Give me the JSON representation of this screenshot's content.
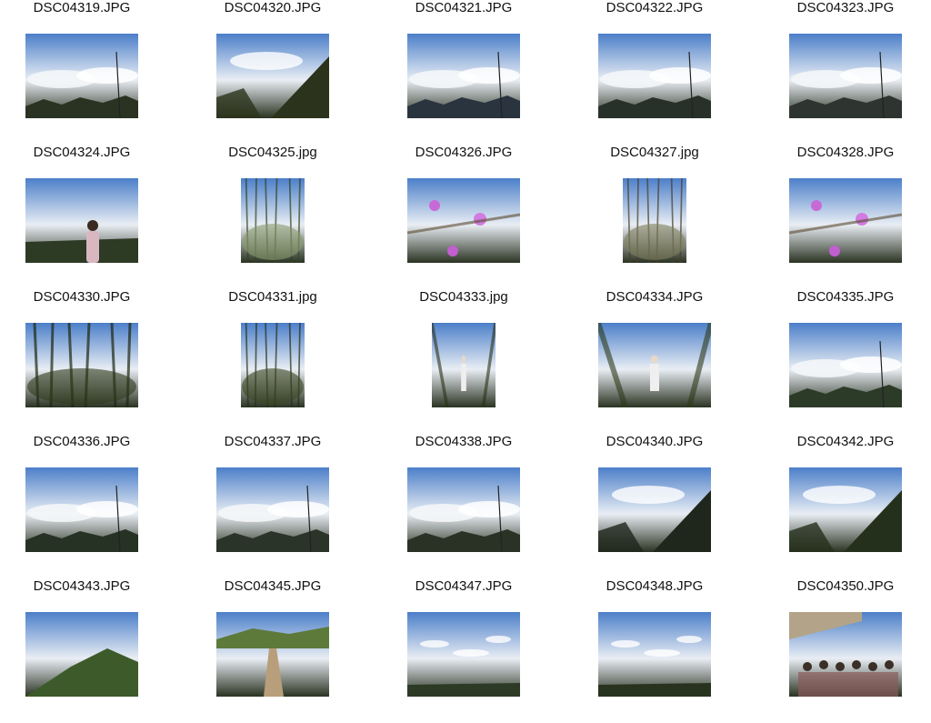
{
  "thumbnails": [
    {
      "filename": "DSC04319.JPG",
      "orientation": "landscape",
      "scene": "sky-clouds",
      "palette": {
        "top": "#4c7fc9",
        "mid": "#e9eef4",
        "bottom": "#2a3322"
      }
    },
    {
      "filename": "DSC04320.JPG",
      "orientation": "landscape",
      "scene": "sky-ridge",
      "palette": {
        "top": "#3f74c4",
        "mid": "#cfdcea",
        "bottom": "#2c331c"
      }
    },
    {
      "filename": "DSC04321.JPG",
      "orientation": "landscape",
      "scene": "sea-of-clouds",
      "palette": {
        "top": "#6e7d8c",
        "mid": "#eef1f4",
        "bottom": "#29343f"
      }
    },
    {
      "filename": "DSC04322.JPG",
      "orientation": "landscape",
      "scene": "sea-of-clouds",
      "palette": {
        "top": "#5f7fa5",
        "mid": "#e3e9ef",
        "bottom": "#27312a"
      }
    },
    {
      "filename": "DSC04323.JPG",
      "orientation": "landscape",
      "scene": "sea-of-clouds",
      "palette": {
        "top": "#8393a3",
        "mid": "#e2e6ea",
        "bottom": "#2e3430"
      }
    },
    {
      "filename": "DSC04324.JPG",
      "orientation": "landscape",
      "scene": "person-sky",
      "palette": {
        "top": "#4f83c9",
        "mid": "#e7ecf1",
        "bottom": "#2d3a24"
      }
    },
    {
      "filename": "DSC04325.jpg",
      "orientation": "portrait",
      "scene": "bamboo-sky",
      "palette": {
        "top": "#7fb0e0",
        "mid": "#8a9b6e",
        "bottom": "#2f4420"
      }
    },
    {
      "filename": "DSC04326.JPG",
      "orientation": "landscape",
      "scene": "flowers-ground",
      "palette": {
        "top": "#6a5a3e",
        "mid": "#8b7351",
        "bottom": "#4a3d28"
      }
    },
    {
      "filename": "DSC04327.jpg",
      "orientation": "portrait",
      "scene": "bamboo-trail",
      "palette": {
        "top": "#a9a98f",
        "mid": "#7e7f5e",
        "bottom": "#4a3e2a"
      }
    },
    {
      "filename": "DSC04328.JPG",
      "orientation": "landscape",
      "scene": "forest-floor",
      "palette": {
        "top": "#6e7a48",
        "mid": "#9a8e6c",
        "bottom": "#5d4e34"
      }
    },
    {
      "filename": "DSC04330.JPG",
      "orientation": "landscape",
      "scene": "dark-forest",
      "palette": {
        "top": "#5f6f3a",
        "mid": "#2f3b1c",
        "bottom": "#1f2812"
      }
    },
    {
      "filename": "DSC04331.jpg",
      "orientation": "portrait",
      "scene": "dark-forest",
      "palette": {
        "top": "#7b8a58",
        "mid": "#3a4522",
        "bottom": "#252e16"
      }
    },
    {
      "filename": "DSC04333.jpg",
      "orientation": "portrait",
      "scene": "hikers-forest",
      "palette": {
        "top": "#4a5f2c",
        "mid": "#33421e",
        "bottom": "#2a3118"
      }
    },
    {
      "filename": "DSC04334.JPG",
      "orientation": "landscape",
      "scene": "hikers-forest",
      "palette": {
        "top": "#51672f",
        "mid": "#3b4d22",
        "bottom": "#2d3a1a"
      }
    },
    {
      "filename": "DSC04335.JPG",
      "orientation": "landscape",
      "scene": "sea-of-clouds",
      "palette": {
        "top": "#3f7ad0",
        "mid": "#e8edf3",
        "bottom": "#2c3a28"
      }
    },
    {
      "filename": "DSC04336.JPG",
      "orientation": "landscape",
      "scene": "sea-of-clouds",
      "palette": {
        "top": "#2f6fc7",
        "mid": "#eef2f6",
        "bottom": "#263224"
      }
    },
    {
      "filename": "DSC04337.JPG",
      "orientation": "landscape",
      "scene": "sea-of-clouds",
      "palette": {
        "top": "#356fbf",
        "mid": "#e9eef3",
        "bottom": "#2a3428"
      }
    },
    {
      "filename": "DSC04338.JPG",
      "orientation": "landscape",
      "scene": "sea-of-clouds",
      "palette": {
        "top": "#3a74c2",
        "mid": "#e5eaf0",
        "bottom": "#2a3226"
      }
    },
    {
      "filename": "DSC04340.JPG",
      "orientation": "landscape",
      "scene": "dark-ridge-clouds",
      "palette": {
        "top": "#8aa3bd",
        "mid": "#eef1f4",
        "bottom": "#1f261c"
      }
    },
    {
      "filename": "DSC04342.JPG",
      "orientation": "landscape",
      "scene": "sky-ridge",
      "palette": {
        "top": "#5e8fd0",
        "mid": "#b9c9da",
        "bottom": "#25301c"
      }
    },
    {
      "filename": "DSC04343.JPG",
      "orientation": "landscape",
      "scene": "misty-ridge",
      "palette": {
        "top": "#c9cdd0",
        "mid": "#a7aeb2",
        "bottom": "#3d5a2a"
      }
    },
    {
      "filename": "DSC04345.JPG",
      "orientation": "landscape",
      "scene": "meadow-trail",
      "palette": {
        "top": "#8fb6e0",
        "mid": "#6f8c48",
        "bottom": "#9aa56a"
      }
    },
    {
      "filename": "DSC04347.JPG",
      "orientation": "landscape",
      "scene": "mackerel-sky",
      "palette": {
        "top": "#3a73c4",
        "mid": "#b7cbe3",
        "bottom": "#2c3a26"
      }
    },
    {
      "filename": "DSC04348.JPG",
      "orientation": "landscape",
      "scene": "mackerel-sky",
      "palette": {
        "top": "#2f67b8",
        "mid": "#c4d3e6",
        "bottom": "#28331f"
      }
    },
    {
      "filename": "DSC04350.JPG",
      "orientation": "landscape",
      "scene": "group-photo",
      "palette": {
        "top": "#d9dde0",
        "mid": "#8a7a64",
        "bottom": "#3a3028"
      }
    }
  ]
}
